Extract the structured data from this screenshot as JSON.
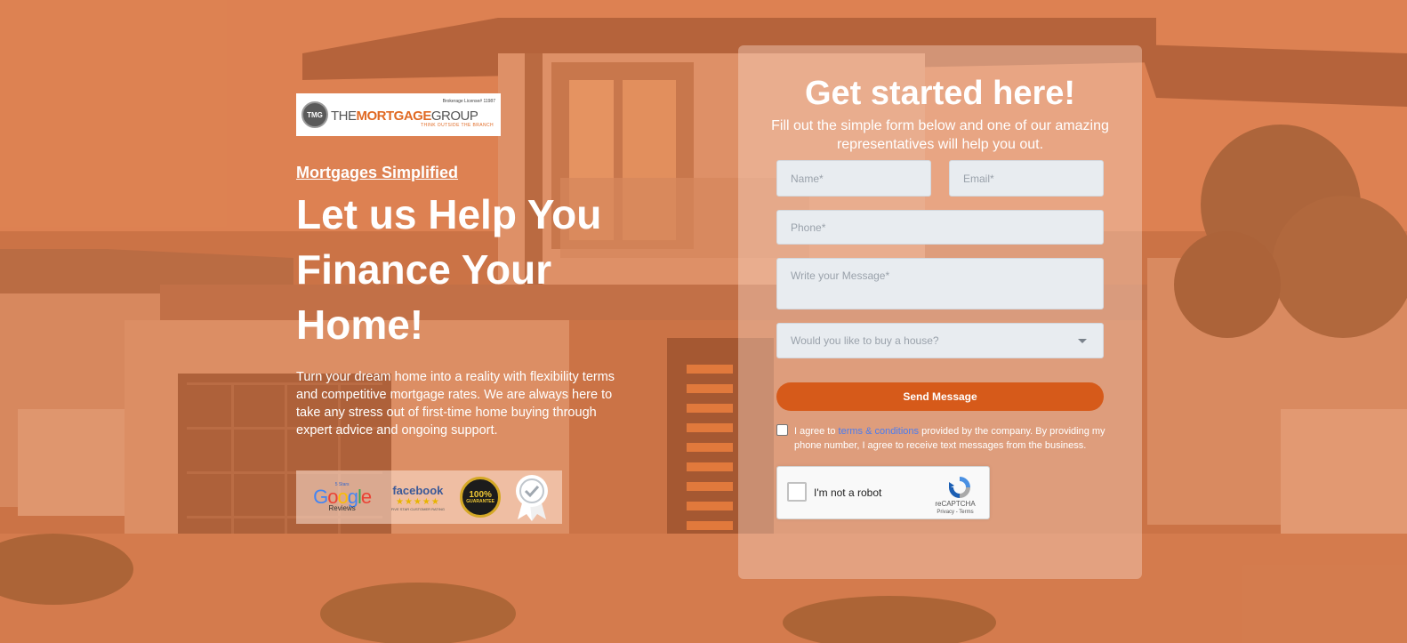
{
  "brand": {
    "logo_mark": "TMG",
    "logo_license": "Brokerage License# 11987",
    "logo_the": "THE",
    "logo_mortgage": "MORTGAGE",
    "logo_group": "GROUP",
    "logo_tagline": "THINK OUTSIDE THE BRANCH"
  },
  "hero": {
    "eyebrow": "Mortgages Simplified",
    "headline": "Let us Help You Finance Your Home!",
    "intro": "Turn your dream home into a reality with flexibility terms and competitive mortgage rates. We are always here to take any stress out of first-time home buying through expert advice and ongoing support."
  },
  "badges": {
    "google_stars": "5 Stars",
    "google_word": "Google",
    "google_reviews": "Reviews",
    "facebook_word": "facebook",
    "facebook_stars": "★★★★★",
    "facebook_caption": "FIVE STAR CUSTOMER RATING",
    "guarantee_value": "100%",
    "guarantee_caption": "GUARANTEE"
  },
  "form": {
    "title": "Get started here!",
    "subtitle": "Fill out the simple form below and one of our amazing representatives will help you out.",
    "name_placeholder": "Name*",
    "email_placeholder": "Email*",
    "phone_placeholder": "Phone*",
    "message_placeholder": "Write your Message*",
    "select_value": "Would you like to buy a house?",
    "submit_label": "Send Message",
    "consent_prefix": "I agree to ",
    "consent_link": "terms & conditions",
    "consent_suffix": " provided by the company. By providing my phone number, I agree to receive text messages from the business."
  },
  "captcha": {
    "label": "I'm not a robot",
    "brand": "reCAPTCHA",
    "links": "Privacy - Terms"
  },
  "colors": {
    "accent": "#d65a1a",
    "overlay": "#e26e32",
    "link": "#4a7cf0",
    "field_bg": "#e8ecf0"
  }
}
